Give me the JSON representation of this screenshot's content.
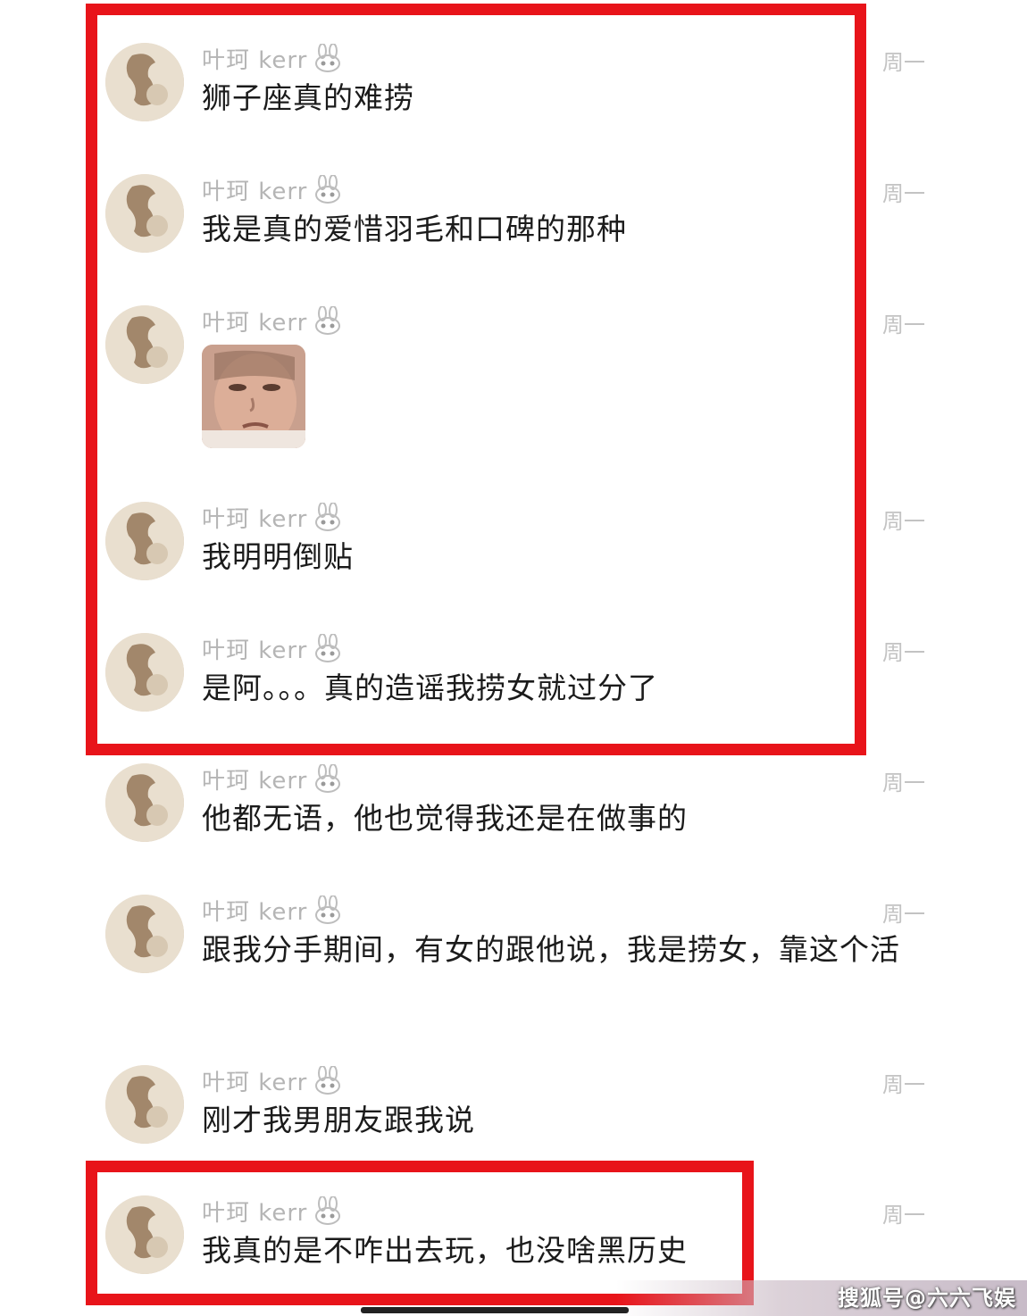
{
  "messages": [
    {
      "sender": "叶珂 kerr",
      "time": "周一",
      "text": "狮子座真的难捞"
    },
    {
      "sender": "叶珂 kerr",
      "time": "周一",
      "text": "我是真的爱惜羽毛和口碑的那种"
    },
    {
      "sender": "叶珂 kerr",
      "time": "周一",
      "sticker": "face-sticker"
    },
    {
      "sender": "叶珂 kerr",
      "time": "周一",
      "text": "我明明倒贴"
    },
    {
      "sender": "叶珂 kerr",
      "time": "周一",
      "text": "是阿。。。真的造谣我捞女就过分了"
    },
    {
      "sender": "叶珂 kerr",
      "time": "周一",
      "text": "他都无语，他也觉得我还是在做事的"
    },
    {
      "sender": "叶珂 kerr",
      "time": "周一",
      "text": "跟我分手期间，有女的跟他说，我是捞女，靠这个活"
    },
    {
      "sender": "叶珂 kerr",
      "time": "周一",
      "text": "刚才我男朋友跟我说"
    },
    {
      "sender": "叶珂 kerr",
      "time": "周一",
      "text": "我真的是不咋出去玩，也没啥黑历史"
    }
  ],
  "icons": {
    "sender_badge": "bunny-icon"
  },
  "highlight_color": "#e8141a",
  "watermark": "搜狐号@六六飞娱"
}
